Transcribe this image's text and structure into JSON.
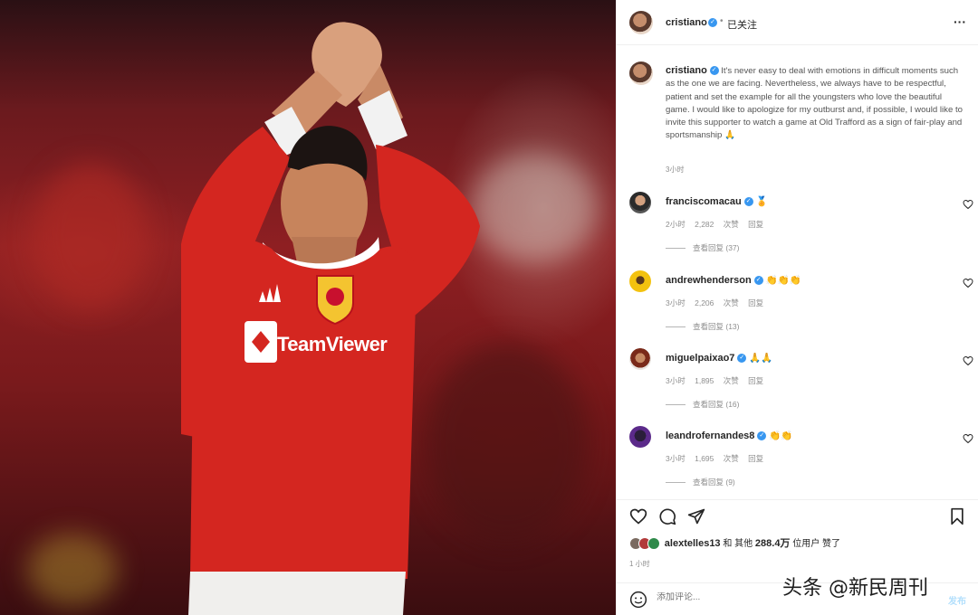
{
  "header": {
    "username": "cristiano",
    "follow_status": "已关注",
    "more_label": "···"
  },
  "caption": {
    "username": "cristiano",
    "text": "It's never easy to deal with emotions in difficult moments such as the one we are facing. Nevertheless, we always have to be respectful, patient and set the example for all the youngsters who love the beautiful game. I would like to apologize for my outburst and, if possible, I would like to invite this supporter to watch a game at Old Trafford as a sign of fair-play and sportsmanship 🙏",
    "time": "3小时"
  },
  "comments": [
    {
      "username": "franciscomacau",
      "text": "🏅",
      "time": "2小时",
      "likes": "2,282 次赞",
      "reply": "回复",
      "view_replies": "查看回复 (37)"
    },
    {
      "username": "andrewhenderson",
      "text": "👏👏👏",
      "time": "3小时",
      "likes": "2,206 次赞",
      "reply": "回复",
      "view_replies": "查看回复 (13)"
    },
    {
      "username": "miguelpaixao7",
      "text": "🙏🙏",
      "time": "3小时",
      "likes": "1,895 次赞",
      "reply": "回复",
      "view_replies": "查看回复 (16)"
    },
    {
      "username": "leandrofernandes8",
      "text": "👏👏",
      "time": "3小时",
      "likes": "1,695 次赞",
      "reply": "回复",
      "view_replies": "查看回复 (9)"
    }
  ],
  "likes": {
    "liker": "alextelles13",
    "text_mid": " 和 其他 ",
    "count": "288.4万",
    "text_end": " 位用户 赞了"
  },
  "post_time": "1 小时",
  "add_comment": {
    "placeholder": "添加评论...",
    "post_label": "发布"
  },
  "jersey": {
    "sponsor": "TeamViewer"
  },
  "watermark": "头条 @新民周刊",
  "icons": {
    "like": "heart-icon",
    "comment": "comment-icon",
    "share": "share-icon",
    "save": "bookmark-icon",
    "emoji": "emoji-icon",
    "verified": "verified-badge-icon",
    "more": "more-options-icon"
  },
  "colors": {
    "verified": "#3897f0",
    "jersey_red": "#d42620",
    "panel_bg": "#ffffff"
  }
}
